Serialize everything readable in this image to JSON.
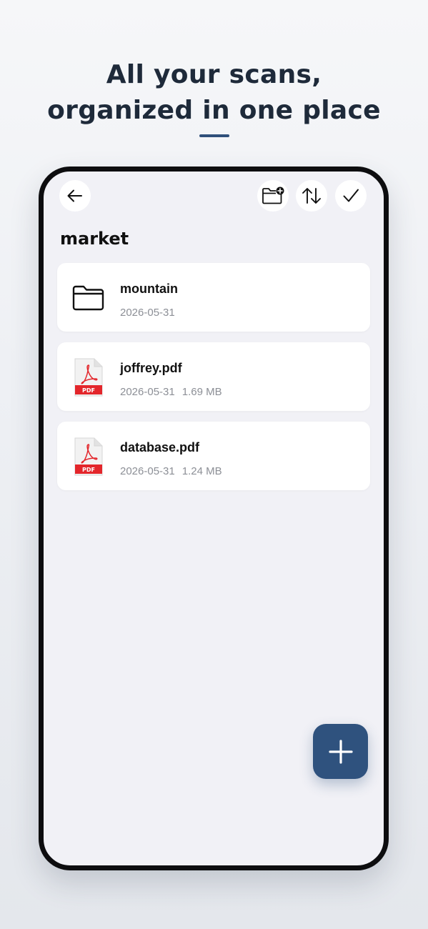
{
  "headline": {
    "line1": "All your scans,",
    "line2": "organized in one place"
  },
  "colors": {
    "accent": "#2f527e",
    "headline": "#1e2a3a",
    "pdf_red": "#e3262b"
  },
  "toolbar": {
    "back_icon": "arrow-left-icon",
    "new_folder_icon": "folder-plus-icon",
    "sort_icon": "sort-arrows-icon",
    "select_icon": "checkmark-icon"
  },
  "folder": {
    "title": "market"
  },
  "files": [
    {
      "type": "folder",
      "icon": "folder-icon",
      "name": "mountain",
      "date": "2026-05-31",
      "size": ""
    },
    {
      "type": "pdf",
      "icon": "pdf-file-icon",
      "badge": "PDF",
      "name": "joffrey.pdf",
      "date": "2026-05-31",
      "size": "1.69 MB"
    },
    {
      "type": "pdf",
      "icon": "pdf-file-icon",
      "badge": "PDF",
      "name": "database.pdf",
      "date": "2026-05-31",
      "size": "1.24 MB"
    }
  ],
  "fab": {
    "icon": "plus-icon"
  }
}
